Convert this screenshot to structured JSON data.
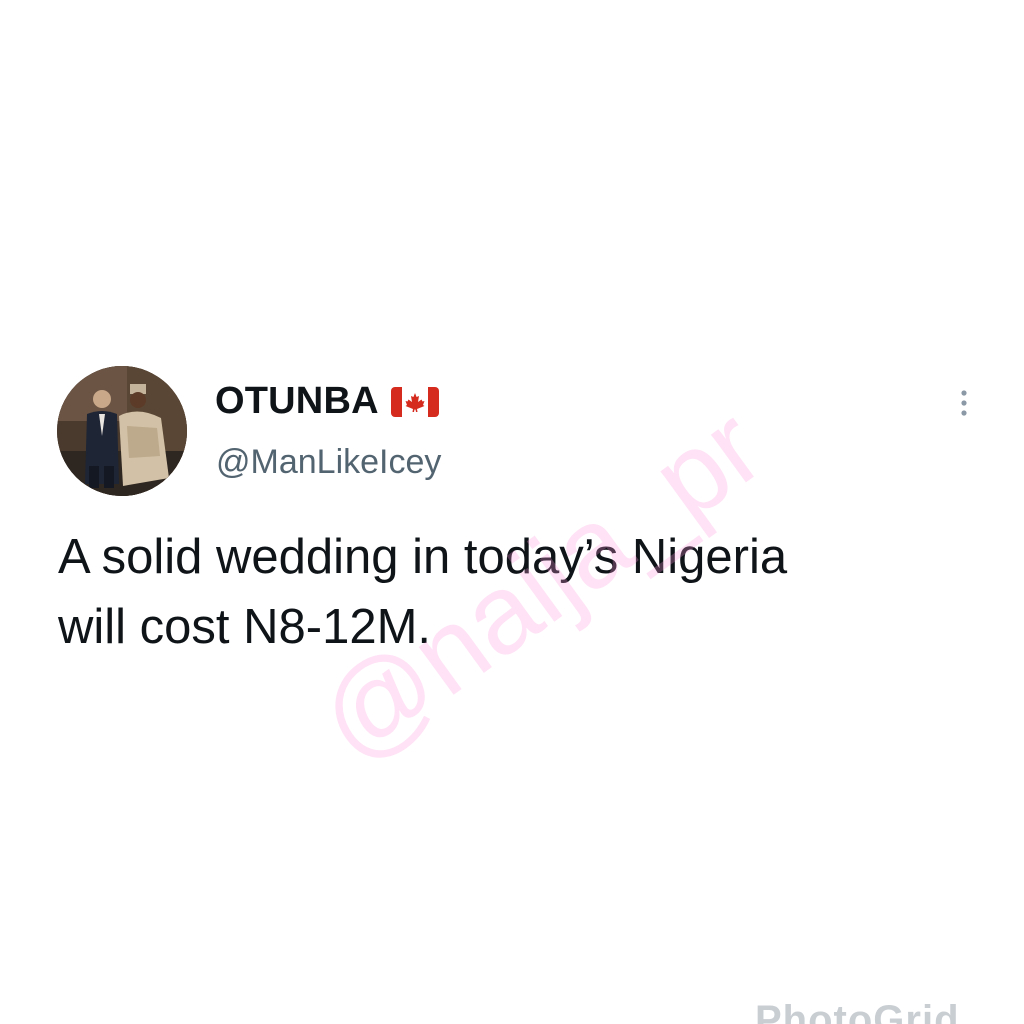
{
  "tweet": {
    "display_name": "OTUNBA",
    "name_flag_icon": "canada-flag-icon",
    "handle": "@ManLikeIcey",
    "text": "A solid wedding in today’s Nigeria\nwill cost N8-12M.",
    "more_icon": "more-vertical-icon",
    "avatar_icon": "profile-photo"
  },
  "watermark": {
    "text": "@naija_pr",
    "color": "#ff96dc"
  },
  "footer_watermark": {
    "text": "PhotoGrid"
  },
  "colors": {
    "text_primary": "#0f1419",
    "text_secondary": "#536471",
    "flag_red": "#d52b1e",
    "background": "#ffffff"
  }
}
